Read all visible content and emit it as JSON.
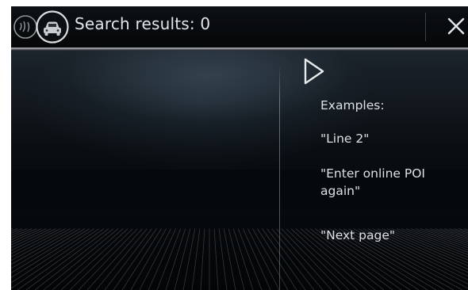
{
  "header": {
    "title": "Search results: 0",
    "icons": {
      "voice": "voice-control-icon",
      "car": "car-icon",
      "close": "close-icon"
    }
  },
  "examples": {
    "heading": "Examples:",
    "items": [
      "\"Line 2\"",
      "\"Enter online POI again\"",
      "\"Next page\""
    ]
  },
  "colors": {
    "background": "#06090c",
    "text": "#e3e6e8",
    "accent": "#9aa3ab"
  }
}
